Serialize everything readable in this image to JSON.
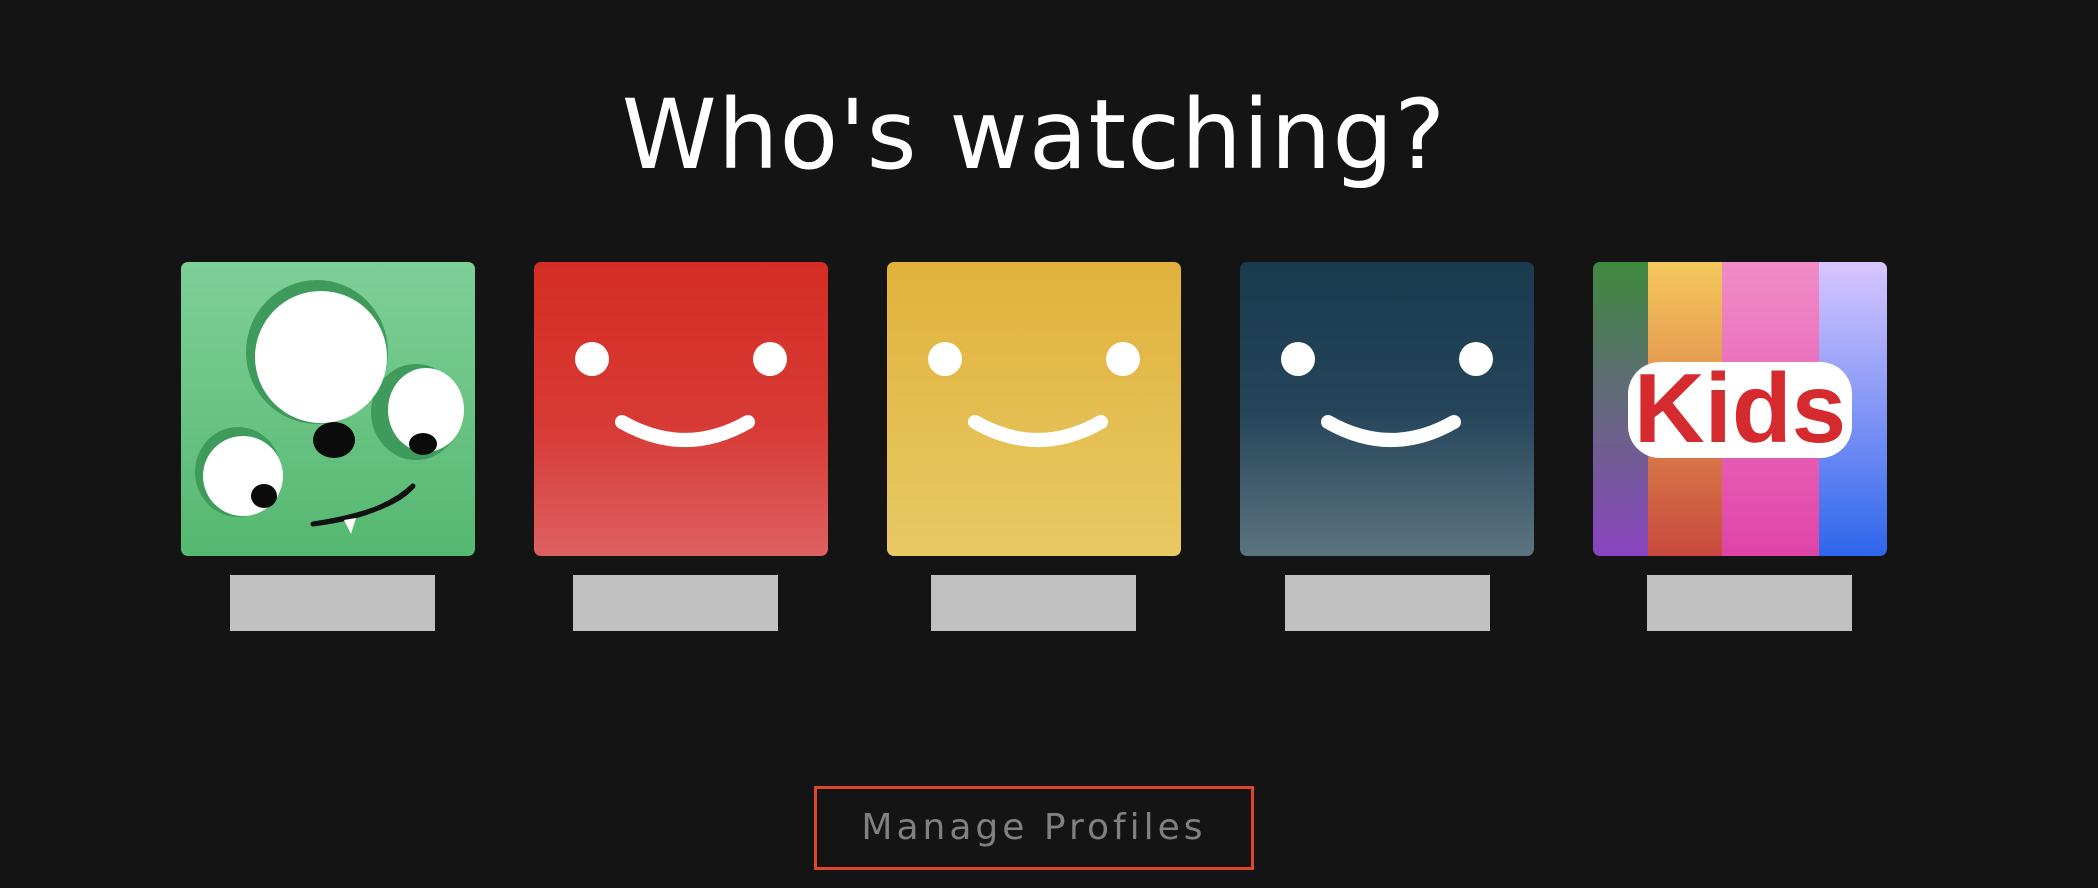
{
  "heading": "Who's watching?",
  "profiles": [
    {
      "avatar_icon": "green-monster-avatar-icon",
      "name": "",
      "bg_color": "#5dbd7a"
    },
    {
      "avatar_icon": "red-smiley-avatar-icon",
      "name": "",
      "bg_color": "#d63a30"
    },
    {
      "avatar_icon": "yellow-smiley-avatar-icon",
      "name": "",
      "bg_color": "#e3b940"
    },
    {
      "avatar_icon": "navy-smiley-avatar-icon",
      "name": "",
      "bg_color": "#1f3c4f"
    },
    {
      "avatar_icon": "kids-avatar-icon",
      "name": "",
      "bg_color": "#f36ab5",
      "logo_text": "Kids"
    }
  ],
  "manage_button": "Manage Profiles",
  "colors": {
    "background": "#141414",
    "heading": "#ffffff",
    "name_placeholder": "#c0c0c0",
    "manage_border": "#e0452b",
    "manage_text": "#808080"
  }
}
